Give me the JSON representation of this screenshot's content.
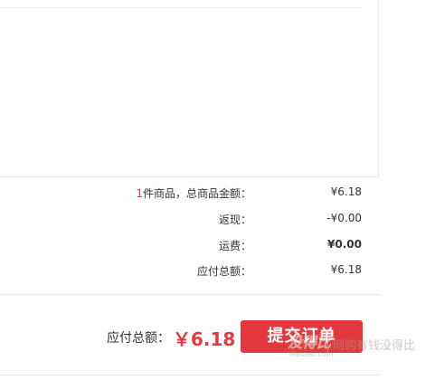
{
  "summary": {
    "items_count": "1",
    "items_label": "件商品，总商品金额：",
    "items_value": "¥6.18",
    "rebate_label": "返现：",
    "rebate_value": "-¥0.00",
    "shipping_label": "运费：",
    "shipping_value": "¥0.00",
    "payable_label": "应付总额：",
    "payable_value": "¥6.18"
  },
  "checkout": {
    "total_label": "应付总额：",
    "total_value": "￥6.18",
    "submit_label": "提交订单"
  },
  "watermark": {
    "logo": "没得比",
    "site": "Meideo.com",
    "slogan": "网购有钱没得比"
  },
  "colors": {
    "accent": "#e4393c",
    "text": "#333333",
    "border": "#e6e6e6"
  }
}
